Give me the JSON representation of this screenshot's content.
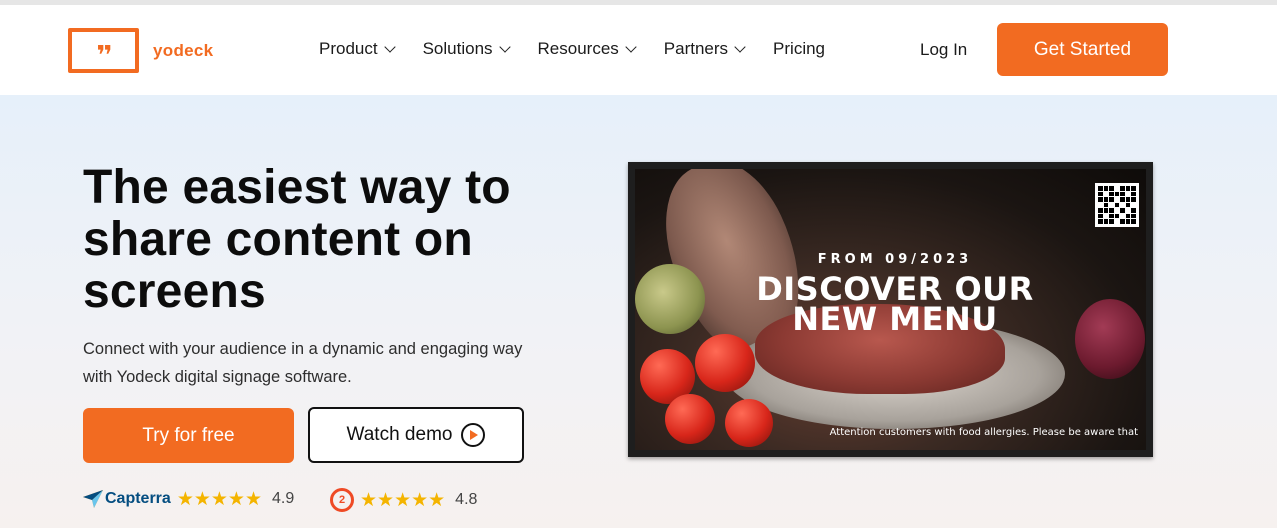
{
  "brand": {
    "name": "yodeck",
    "accent": "#f26b21",
    "logo_icon": "quote-icon"
  },
  "nav": {
    "items": [
      {
        "label": "Product",
        "dropdown": true
      },
      {
        "label": "Solutions",
        "dropdown": true
      },
      {
        "label": "Resources",
        "dropdown": true
      },
      {
        "label": "Partners",
        "dropdown": true
      },
      {
        "label": "Pricing",
        "dropdown": false
      }
    ],
    "login": "Log In",
    "cta": "Get Started"
  },
  "hero": {
    "headline": "The easiest way to share content on screens",
    "subtitle": "Connect with your audience in a dynamic and engaging way with Yodeck digital signage software.",
    "primary_button": "Try for free",
    "secondary_button": "Watch demo",
    "ratings": [
      {
        "source": "Capterra",
        "stars": "★★★★★",
        "score": "4.9",
        "icon": "capterra-logo-icon"
      },
      {
        "source": "G2",
        "stars": "★★★★★",
        "score": "4.8",
        "icon": "g2-logo-icon"
      }
    ]
  },
  "signage_preview": {
    "date_line": "FROM 09/2023",
    "title_line1": "DISCOVER OUR",
    "title_line2": "NEW MENU",
    "ticker": "Attention customers with food allergies. Please be aware that"
  }
}
